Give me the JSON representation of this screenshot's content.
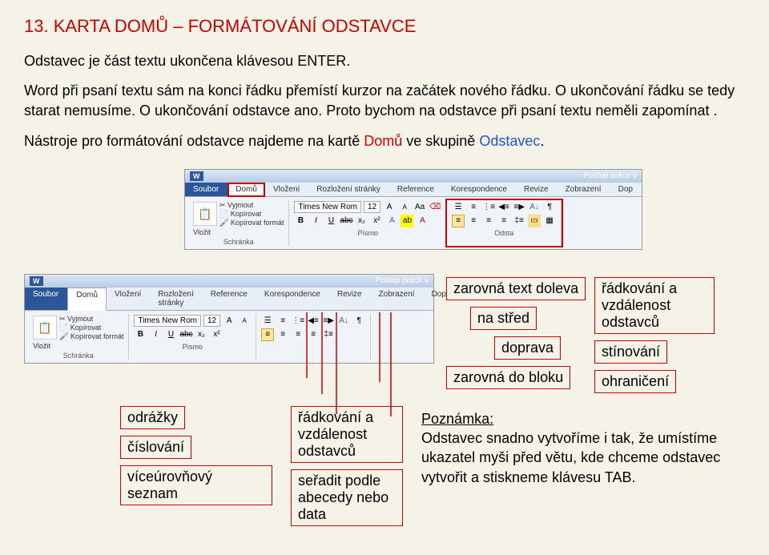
{
  "title": "13. KARTA DOMŮ – FORMÁTOVÁNÍ ODSTAVCE",
  "para1": "Odstavec je část textu ukončena klávesou ENTER.",
  "para2": "Word při psaní textu sám na konci řádku přemístí kurzor na začátek nového řádku. O ukončování řádku se tedy starat nemusíme. O ukončování odstavce ano. Proto bychom na odstavce při psaní textu neměli zapomínat .",
  "para3_a": "Nástroje pro formátování odstavce najdeme na kartě ",
  "para3_domu": "Domů",
  "para3_b": " ve skupině ",
  "para3_odstavec": "Odstavec",
  "para3_c": ".",
  "ribbon": {
    "wintitle": "Postup práce v",
    "tabs": {
      "file": "Soubor",
      "home": "Domů",
      "insert": "Vložení",
      "layout": "Rozložení stránky",
      "refs": "Reference",
      "mail": "Korespondence",
      "review": "Revize",
      "view": "Zobrazení",
      "dop": "Dop"
    },
    "clipboard": {
      "paste": "Vložit",
      "cut": "Vyjmout",
      "copy": "Kopírovat",
      "fmtpainter": "Kopírovat formát",
      "label": "Schránka"
    },
    "font": {
      "name": "Times New Rom",
      "size": "12",
      "label": "Písmo"
    },
    "paragraph": {
      "label": "Odsta"
    }
  },
  "callouts": {
    "bullets": "odrážky",
    "numbering": "číslování",
    "multilevel": "víceúrovňový seznam",
    "linespacing": "řádkování a vzdálenost odstavců",
    "sort": "seřadit podle abecedy nebo data",
    "alignleft": "zarovná text doleva",
    "aligncenter": "na střed",
    "alignright": "doprava",
    "alignjustify": "zarovná do bloku",
    "linespacing2": "řádkování a vzdálenost odstavců",
    "shading": "stínování",
    "borders": "ohraničení",
    "note_label": "Poznámka:",
    "note_text": "Odstavec snadno vytvoříme i tak, že umístíme ukazatel myši před větu, kde chceme odstavec vytvořit a stiskneme klávesu TAB."
  }
}
